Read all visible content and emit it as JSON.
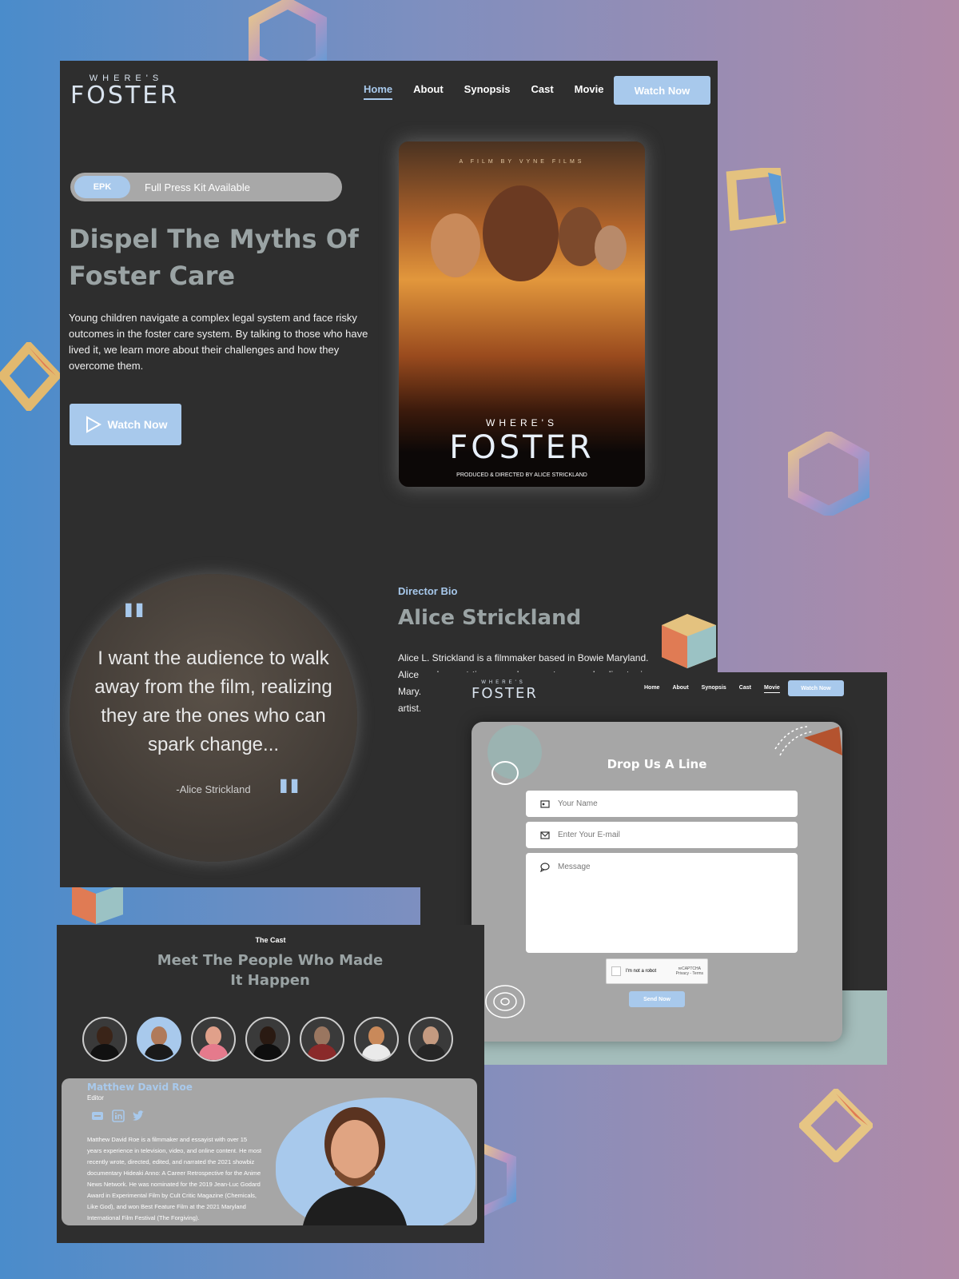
{
  "colors": {
    "accent": "#a8c9ec",
    "panel": "#2e2e2e",
    "card": "#a6a6a6"
  },
  "nav": {
    "logo_small": "WHERE'S",
    "logo_big": "FOSTER",
    "items": [
      {
        "label": "Home"
      },
      {
        "label": "About"
      },
      {
        "label": "Synopsis"
      },
      {
        "label": "Cast"
      },
      {
        "label": "Movie"
      }
    ],
    "cta": "Watch Now"
  },
  "hero": {
    "epk_badge": "EPK",
    "epk_text": "Full Press Kit Available",
    "title": "Dispel The Myths Of Foster Care",
    "description": "Young children navigate a complex legal system and face risky outcomes in the foster care system. By talking to those who have lived it, we learn more about their challenges and how they overcome them.",
    "watch_label": "Watch Now"
  },
  "poster": {
    "credit": "A FILM BY VYNE FILMS",
    "title_small": "WHERE'S",
    "title_big": "FOSTER",
    "producer": "PRODUCED & DIRECTED BY ALICE STRICKLAND"
  },
  "quote": {
    "text": "I want the audience to walk away from the film, realizing they are the ones who can spark change...",
    "author": "-Alice Strickland"
  },
  "director": {
    "tag": "Director Bio",
    "name": "Alice Strickland",
    "bio": "Alice L. Strickland is a filmmaker based in Bowie Maryland. Alice work... part-time as a documentary... and... director in Mary... Cybe... film t... her A... the in... those... the p... plann... artist..."
  },
  "contact": {
    "logo_small": "WHERE'S",
    "logo_big": "FOSTER",
    "nav": [
      {
        "label": "Home"
      },
      {
        "label": "About"
      },
      {
        "label": "Synopsis"
      },
      {
        "label": "Cast"
      },
      {
        "label": "Movie"
      }
    ],
    "cta": "Watch Now",
    "title": "Drop Us A Line",
    "name_placeholder": "Your Name",
    "email_placeholder": "Enter Your E-mail",
    "message_placeholder": "Message",
    "captcha_label": "I'm not a robot",
    "captcha_brand": "reCAPTCHA",
    "captcha_links": "Privacy - Terms",
    "send_label": "Send Now"
  },
  "cast": {
    "tag": "The Cast",
    "title": "Meet The People Who Made It Happen",
    "selected": {
      "name": "Matthew David Roe",
      "role": "Editor",
      "bio": "Matthew David Roe is a filmmaker and essayist with over 15 years experience in television, video, and online content. He most recently wrote, directed, edited, and narrated the 2021 showbiz documentary Hideaki Anno: A Career Retrospective for the Anime News Network. He was nominated for the 2019 Jean-Luc Godard Award in Experimental Film by Cult Critic Magazine (Chemicals, Like God), and won Best Feature Film at the 2021 Maryland International Film Festival (The Forgiving)."
    },
    "socials": [
      "website-icon",
      "linkedin-icon",
      "twitter-icon"
    ]
  }
}
